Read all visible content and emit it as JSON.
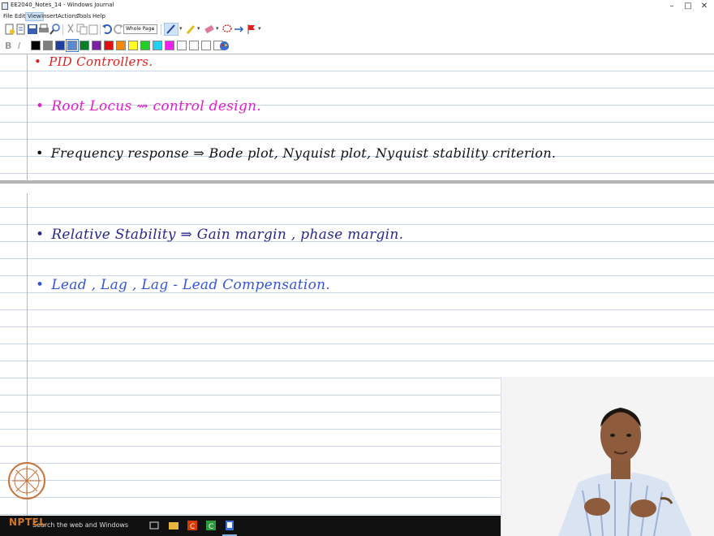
{
  "window": {
    "title": "EE2040_Notes_14 - Windows Journal",
    "controls": {
      "minimize": "–",
      "maximize": "□",
      "close": "✕"
    }
  },
  "menu": [
    "File",
    "Edit",
    "View",
    "Insert",
    "Actions",
    "Tools",
    "Help"
  ],
  "toolbar": {
    "zoom_value": "Whole Page",
    "format_buttons": [
      "B",
      "I"
    ]
  },
  "palette": {
    "colors": [
      "#000000",
      "#7f7f7f",
      "#1f3f9f",
      "#5a8ad6",
      "#0a7f2a",
      "#7a1fa0",
      "#e01010",
      "#f08a10",
      "#ffff20",
      "#20d020",
      "#20d0f0",
      "#f020f0",
      "#ffffff",
      "#ffffff",
      "#ffffff",
      "#ffffff"
    ],
    "selected_index": 3
  },
  "notes": [
    {
      "text": "PID  Controllers.",
      "color": "#e02020"
    },
    {
      "text": "Root Locus  ⇝  control  design.",
      "color": "#e020c8"
    },
    {
      "text": "Frequency response ⇒ Bode  plot,  Nyquist  plot,  Nyquist  stability  criterion.",
      "color": "#111111"
    },
    {
      "text": "Relative Stability ⇒ Gain margin , phase  margin.",
      "color": "#28288e"
    },
    {
      "text": "Lead ,  Lag ,  Lag - Lead  Compensation.",
      "color": "#3555d8"
    }
  ],
  "watermark": {
    "logo_text": "NPTEL"
  },
  "taskbar": {
    "search_placeholder": "Search the web and Windows",
    "apps": [
      "task-view",
      "file-explorer",
      "office",
      "camtasia",
      "journal"
    ]
  }
}
